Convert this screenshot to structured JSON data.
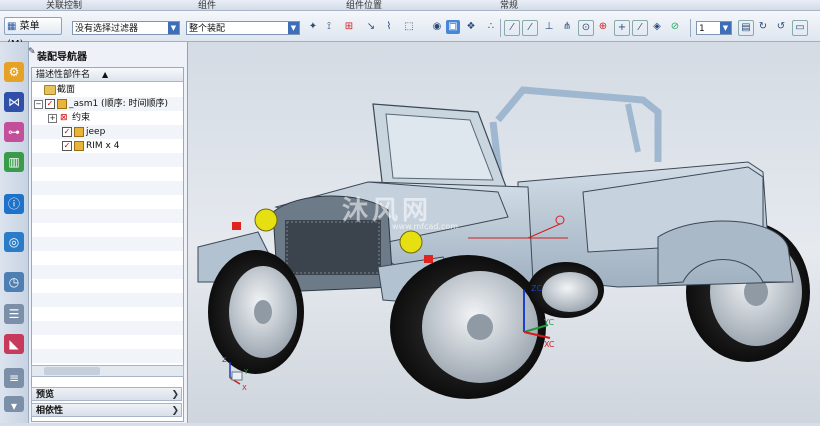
{
  "ribbon_groups": [
    "关联控制",
    "组件",
    "组件位置",
    "常规"
  ],
  "toolbar": {
    "menu_label": "菜单(M)▾",
    "filter_combo": "没有选择过滤器",
    "scope_combo": "整个装配",
    "number_combo": "1"
  },
  "navigator": {
    "title": "装配导航器",
    "column_header": "描述性部件名",
    "rows": [
      {
        "label": "截面"
      },
      {
        "label": "_asm1 (顺序: 时间顺序)"
      },
      {
        "label": "约束"
      },
      {
        "label": "jeep"
      },
      {
        "label": "RIM x 4"
      }
    ],
    "sections": [
      {
        "label": "预览"
      },
      {
        "label": "相依性"
      }
    ]
  },
  "viewport": {
    "watermark": "沐风网",
    "watermark_url": "www.mfcad.com",
    "axis_labels": {
      "zc": "ZC",
      "yc": "YC",
      "xc": "XC",
      "z": "Z",
      "x": "X",
      "y": "Y"
    }
  },
  "colors": {
    "car_body": "#b9c7d4",
    "accent_red": "#e0231f",
    "headlight": "#e6e012",
    "axis_blue": "#1b3fd0",
    "axis_red": "#d21d1d",
    "axis_green": "#1f9a40"
  }
}
